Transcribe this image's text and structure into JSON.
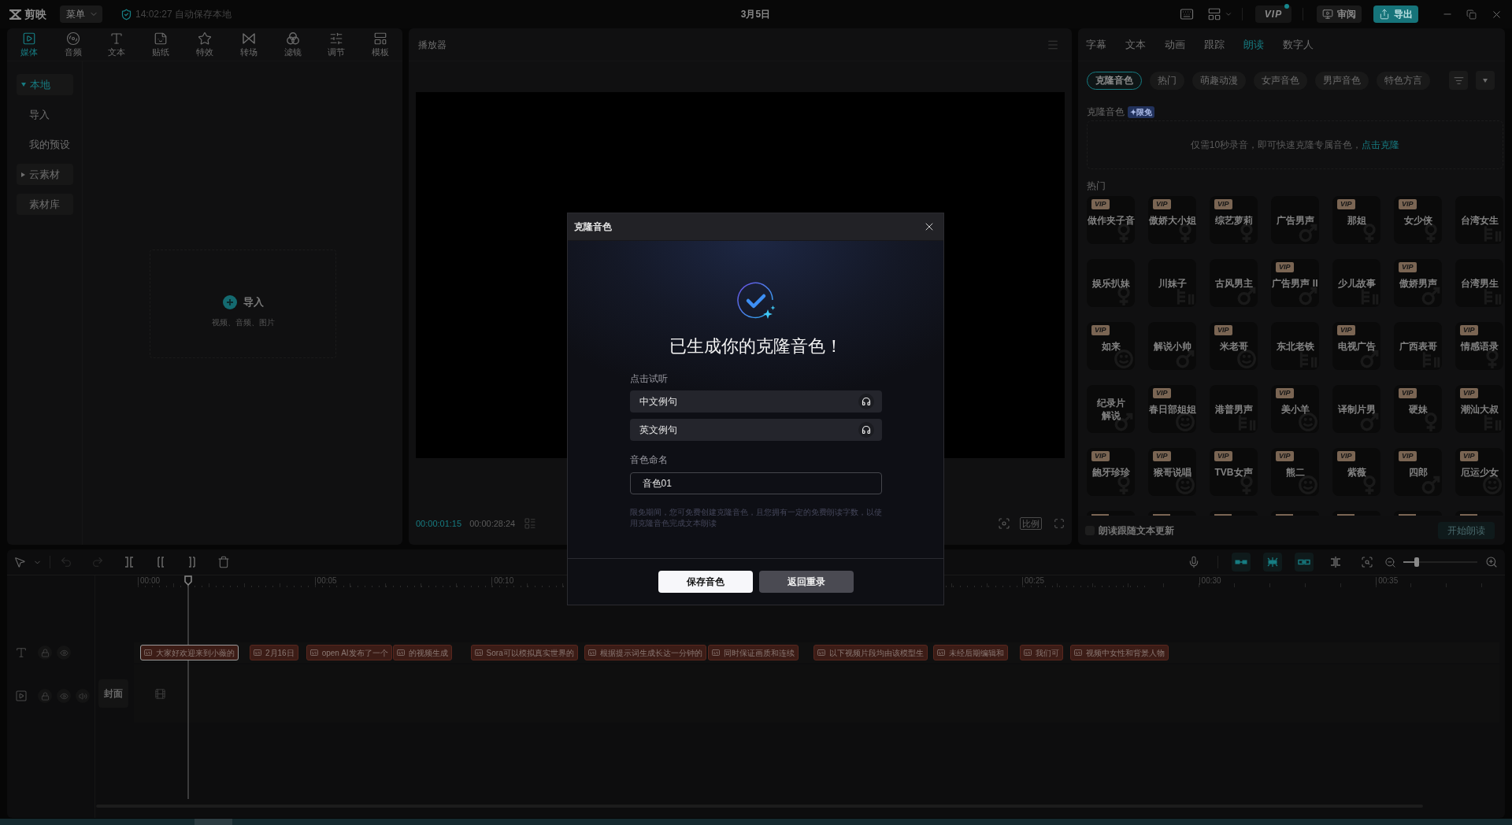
{
  "top_bar": {
    "app_name": "剪映",
    "menu": "菜单",
    "autosave": "14:02:27 自动保存本地",
    "title": "3月5日",
    "vip": {
      "label": "VIP",
      "notify": true
    },
    "review": "审阅",
    "export": "导出"
  },
  "media_panel": {
    "tabs": [
      {
        "label": "媒体",
        "selected": true
      },
      {
        "label": "音频",
        "selected": false
      },
      {
        "label": "文本",
        "selected": false
      },
      {
        "label": "贴纸",
        "selected": false
      },
      {
        "label": "特效",
        "selected": false
      },
      {
        "label": "转场",
        "selected": false
      },
      {
        "label": "滤镜",
        "selected": false
      },
      {
        "label": "调节",
        "selected": false
      },
      {
        "label": "模板",
        "selected": false
      }
    ],
    "sidebar": [
      {
        "label": "本地",
        "selected": true,
        "expanded": true,
        "children": [
          {
            "label": "导入",
            "selected": false
          },
          {
            "label": "我的预设",
            "selected": false
          }
        ]
      },
      {
        "label": "云素材",
        "selected": false,
        "expanded": false
      },
      {
        "label": "素材库",
        "selected": false
      }
    ],
    "import": {
      "label": "导入",
      "hint": "视频、音频、图片"
    }
  },
  "player": {
    "title": "播放器",
    "current_time": "00:00:01:15",
    "duration": "00:00:28:24",
    "ratio": "比例"
  },
  "reading_panel": {
    "tabs": [
      {
        "label": "字幕",
        "selected": false
      },
      {
        "label": "文本",
        "selected": false
      },
      {
        "label": "动画",
        "selected": false
      },
      {
        "label": "跟踪",
        "selected": false
      },
      {
        "label": "朗读",
        "selected": true
      },
      {
        "label": "数字人",
        "selected": false
      }
    ],
    "chips": [
      {
        "label": "克隆音色",
        "selected": true
      },
      {
        "label": "热门",
        "selected": false
      },
      {
        "label": "萌趣动漫",
        "selected": false
      },
      {
        "label": "女声音色",
        "selected": false
      },
      {
        "label": "男声音色",
        "selected": false
      },
      {
        "label": "特色方言",
        "selected": false
      }
    ],
    "clone": {
      "label": "克隆音色",
      "badge": "✦限免",
      "prompt": "仅需10秒录音，即可快速克隆专属音色，",
      "link": "点击克隆"
    },
    "hot_label": "热门",
    "voices": [
      {
        "name": "做作夹子音",
        "badge": "VIP",
        "kind": "female"
      },
      {
        "name": "傲娇大小姐",
        "badge": "VIP",
        "kind": "female"
      },
      {
        "name": "综艺萝莉",
        "badge": "VIP",
        "kind": "female"
      },
      {
        "name": "广告男声",
        "kind": "male"
      },
      {
        "name": "那姐",
        "badge": "VIP",
        "kind": "female"
      },
      {
        "name": "女少侠",
        "badge": "VIP",
        "kind": "female"
      },
      {
        "name": "台湾女生",
        "kind": "bars"
      },
      {
        "name": "娱乐扒妹",
        "kind": "female"
      },
      {
        "name": "川妹子",
        "kind": "bars"
      },
      {
        "name": "古风男主",
        "kind": "male"
      },
      {
        "name": "广告男声 II",
        "badge": "VIP",
        "kind": "male"
      },
      {
        "name": "少儿故事",
        "kind": "bars"
      },
      {
        "name": "傲娇男声",
        "badge": "VIP",
        "kind": "male"
      },
      {
        "name": "台湾男生",
        "kind": "bars"
      },
      {
        "name": "如来",
        "badge": "VIP",
        "kind": "character"
      },
      {
        "name": "解说小帅",
        "kind": "male"
      },
      {
        "name": "米老哥",
        "badge": "VIP",
        "kind": "character"
      },
      {
        "name": "东北老铁",
        "kind": "bars"
      },
      {
        "name": "电视广告",
        "badge": "VIP",
        "kind": "male"
      },
      {
        "name": "广西表哥",
        "kind": "bars"
      },
      {
        "name": "情感语录",
        "badge": "VIP",
        "kind": "female"
      },
      {
        "name_lines": [
          "纪录片",
          "解说"
        ],
        "kind": "male"
      },
      {
        "name": "春日部姐姐",
        "badge": "VIP",
        "kind": "character"
      },
      {
        "name": "港普男声",
        "kind": "bars"
      },
      {
        "name": "美小羊",
        "badge": "VIP",
        "kind": "character"
      },
      {
        "name": "译制片男",
        "kind": "male"
      },
      {
        "name": "硬妹",
        "badge": "VIP",
        "kind": "female"
      },
      {
        "name": "潮汕大叔",
        "badge": "VIP",
        "kind": "bars"
      },
      {
        "name": "龅牙珍珍",
        "badge": "VIP",
        "kind": "female"
      },
      {
        "name": "猴哥说唱",
        "badge": "VIP",
        "kind": "character"
      },
      {
        "name": "TVB女声",
        "badge": "VIP",
        "kind": "female"
      },
      {
        "name": "熊二",
        "badge": "VIP",
        "kind": "character"
      },
      {
        "name": "紫薇",
        "badge": "VIP",
        "kind": "female"
      },
      {
        "name": "四郎",
        "badge": "VIP",
        "kind": "male"
      },
      {
        "name": "厄运少女",
        "badge": "VIP",
        "kind": "character"
      }
    ],
    "clipped_voices": [
      {
        "vip": true
      },
      {
        "vip": true
      },
      {
        "vip": true
      },
      {
        "vip": true
      },
      {
        "vip": true
      },
      {
        "vip": true
      },
      {
        "vip": true
      }
    ],
    "follow_text": {
      "label": "朗读跟随文本更新",
      "checked": false
    },
    "start": {
      "label": "开始朗读",
      "disabled": true
    }
  },
  "timeline": {
    "undo": {
      "disabled": true
    },
    "redo": {
      "disabled": true
    },
    "snap_toggles": [
      {
        "on": true
      },
      {
        "on": true
      },
      {
        "on": true
      }
    ],
    "zoom": {
      "level": 0.18
    },
    "ruler": [
      "00:00",
      "00:05",
      "00:10",
      "00:25",
      "00:30",
      "00:35"
    ],
    "text_clips": [
      {
        "text": "大家好欢迎来到小薇的",
        "selected": true
      },
      {
        "text": "2月16日",
        "selected": false
      },
      {
        "text": "open AI发布了一个",
        "selected": false
      },
      {
        "text": "的视频生成",
        "selected": false
      },
      {
        "text": "Sora可以模拟真实世界的",
        "selected": false
      },
      {
        "text": "根据提示词生成长达一分钟的",
        "selected": false
      },
      {
        "text": "同时保证画质和连续",
        "selected": false
      },
      {
        "text": "以下视频片段均由该模型生",
        "selected": false
      },
      {
        "text": "未经后期编辑和",
        "selected": false
      },
      {
        "text": "我们可",
        "selected": false
      },
      {
        "text": "视频中女性和背景人物",
        "selected": false
      }
    ],
    "cover": "封面"
  },
  "dialog": {
    "title": "克隆音色",
    "heading": "已生成你的克隆音色！",
    "preview_label": "点击试听",
    "samples": [
      "中文例句",
      "英文例句"
    ],
    "name_label": "音色命名",
    "name_value": "音色01",
    "note": "限免期间，您可免费创建克隆音色，且您拥有一定的免费朗读字数，以使用克隆音色完成文本朗读",
    "buttons": [
      {
        "label": "保存音色",
        "kind": "primary"
      },
      {
        "label": "返回重录",
        "kind": "secondary"
      }
    ]
  }
}
